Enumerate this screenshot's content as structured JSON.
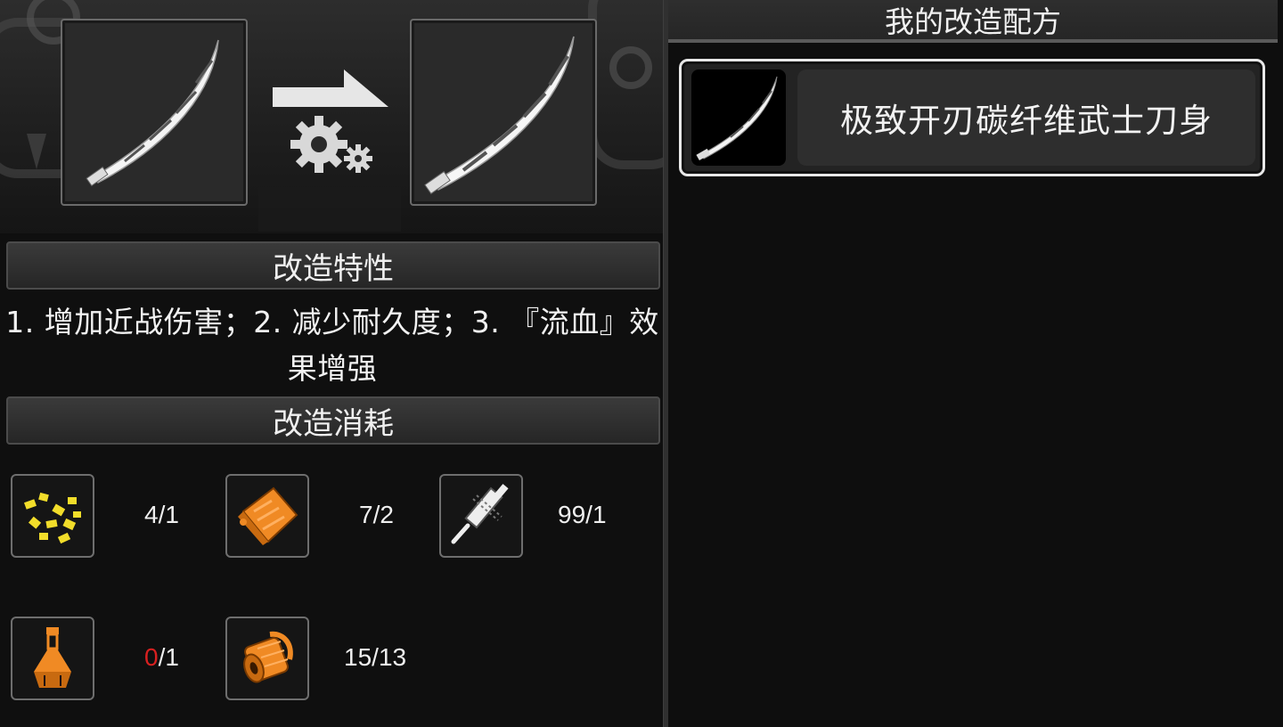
{
  "modify_panel": {
    "source_item": {
      "icon": "katana-icon"
    },
    "result_item": {
      "icon": "katana-icon"
    },
    "traits_header": "改造特性",
    "traits_text": "1. 增加近战伤害；2. 减少耐久度；3. 『流血』效果增强",
    "cost_header": "改造消耗",
    "costs": [
      {
        "icon": "gold-nuggets-icon",
        "have": "4",
        "need": "1"
      },
      {
        "icon": "orange-material-icon",
        "have": "7",
        "need": "2"
      },
      {
        "icon": "whetstone-tool-icon",
        "have": "99",
        "need": "1"
      },
      {
        "icon": "potion-flask-icon",
        "have": "0",
        "need": "1"
      },
      {
        "icon": "copper-coil-icon",
        "have": "15",
        "need": "13"
      }
    ],
    "colors": {
      "insufficient": "#d82020",
      "orange": "#f08a24",
      "gold": "#f2dd2a"
    }
  },
  "recipes_panel": {
    "title": "我的改造配方",
    "recipes": [
      {
        "name": "极致开刃碳纤维武士刀身",
        "icon": "katana-icon",
        "selected": true
      }
    ]
  }
}
